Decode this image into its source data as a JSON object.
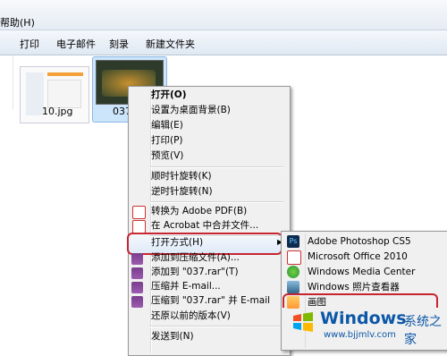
{
  "menubar": {
    "help": "帮助(H)"
  },
  "toolbar": {
    "items": [
      "打印",
      "电子邮件",
      "刻录",
      "新建文件夹"
    ]
  },
  "files": [
    {
      "name": "10.jpg"
    },
    {
      "name": "037",
      "selected": true
    }
  ],
  "context_menu": {
    "items": [
      {
        "label": "打开(O)",
        "bold": true
      },
      {
        "label": "设置为桌面背景(B)"
      },
      {
        "label": "编辑(E)"
      },
      {
        "label": "打印(P)"
      },
      {
        "label": "预览(V)"
      },
      {
        "label": "顺时针旋转(K)"
      },
      {
        "label": "逆时针旋转(N)"
      },
      {
        "label": "转换为 Adobe PDF(B)",
        "icon": "pdf-icon"
      },
      {
        "label": "在 Acrobat 中合并文件...",
        "icon": "acrobat-icon"
      },
      {
        "label": "打开方式(H)",
        "highlighted": true,
        "submenu": true
      },
      {
        "label": "添加到压缩文件(A)...",
        "icon": "winrar-icon"
      },
      {
        "label": "添加到 \"037.rar\"(T)",
        "icon": "winrar-icon"
      },
      {
        "label": "压缩并 E-mail...",
        "icon": "winrar-icon"
      },
      {
        "label": "压缩到 \"037.rar\" 并 E-mail",
        "icon": "winrar-icon"
      },
      {
        "label": "还原以前的版本(V)"
      },
      {
        "label": "发送到(N)"
      }
    ]
  },
  "submenu": {
    "items": [
      {
        "label": "Adobe Photoshop CS5",
        "icon": "photoshop-icon"
      },
      {
        "label": "Microsoft Office 2010",
        "icon": "office-icon"
      },
      {
        "label": "Windows Media Center",
        "icon": "media-center-icon"
      },
      {
        "label": "Windows 照片查看器",
        "icon": "photo-viewer-icon"
      },
      {
        "label": "画图",
        "icon": "paint-icon",
        "highlighted": true
      }
    ]
  },
  "watermark": {
    "brand": "Windows",
    "cn": "系统之家",
    "url": "www.bjjmlv.com"
  },
  "colors": {
    "highlight_border": "#c8242f",
    "selection": "#cde5fb",
    "brand": "#0c57a7"
  }
}
